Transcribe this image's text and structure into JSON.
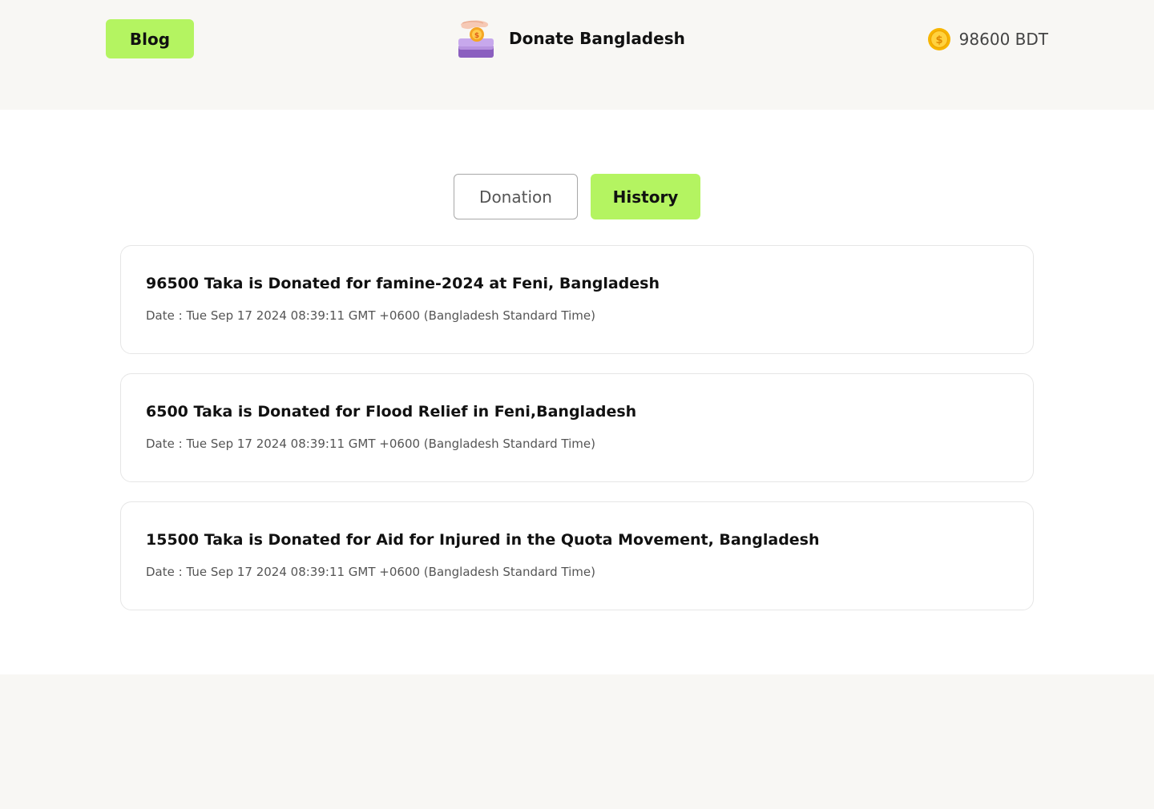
{
  "header": {
    "blog_label": "Blog",
    "brand_title": "Donate Bangladesh",
    "logo_icon": "donation-box-icon",
    "coin_icon": "coin-icon",
    "balance": "98600 BDT"
  },
  "tabs": [
    {
      "label": "Donation",
      "active": false
    },
    {
      "label": "History",
      "active": true
    }
  ],
  "history": [
    {
      "title": "96500 Taka is Donated for famine-2024 at Feni, Bangladesh",
      "date": "Date : Tue Sep 17 2024 08:39:11 GMT +0600 (Bangladesh Standard Time)"
    },
    {
      "title": "6500 Taka is Donated for Flood Relief in Feni,Bangladesh",
      "date": "Date : Tue Sep 17 2024 08:39:11 GMT +0600 (Bangladesh Standard Time)"
    },
    {
      "title": "15500 Taka is Donated for Aid for Injured in the Quota Movement, Bangladesh",
      "date": "Date : Tue Sep 17 2024 08:39:11 GMT +0600 (Bangladesh Standard Time)"
    }
  ],
  "colors": {
    "accent": "#b4f461",
    "page_bg": "#f8f7f4",
    "card_border": "#e6e6e6"
  }
}
